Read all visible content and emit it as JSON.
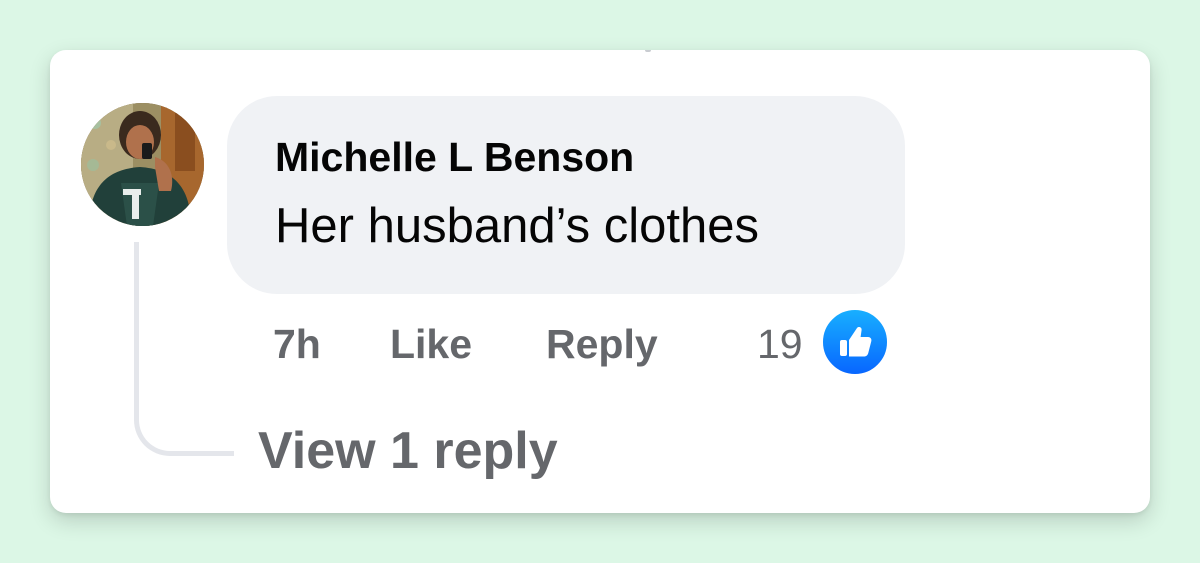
{
  "comment": {
    "author": "Michelle L Benson",
    "text": "Her husband’s clothes",
    "timestamp": "7h",
    "like_label": "Like",
    "reply_label": "Reply",
    "reaction_count": "19",
    "reaction_icon": "thumbs-up-icon",
    "view_replies_label": "View 1 reply"
  },
  "colors": {
    "page_background": "#dcf7e6",
    "card_background": "#ffffff",
    "bubble_background": "#f0f2f5",
    "primary_text": "#050505",
    "secondary_text": "#65676b",
    "like_blue": "#0866ff",
    "thread_line": "#e4e6eb"
  }
}
